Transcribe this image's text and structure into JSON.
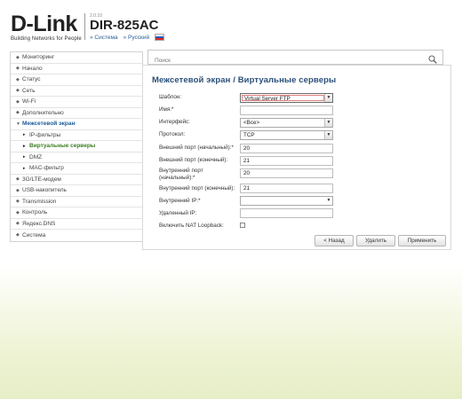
{
  "brand": {
    "logo": "D-Link",
    "tagline": "Building Networks for People"
  },
  "device": {
    "hw": "2.0.10",
    "model": "DIR-825AC",
    "system": "Система",
    "language": "Русский"
  },
  "sidebar": {
    "items": [
      {
        "label": "Мониторинг"
      },
      {
        "label": "Начало"
      },
      {
        "label": "Статус"
      },
      {
        "label": "Сеть"
      },
      {
        "label": "Wi-Fi"
      },
      {
        "label": "Дополнительно"
      },
      {
        "label": "Межсетевой экран"
      },
      {
        "label": "IP-фильтры"
      },
      {
        "label": "Виртуальные серверы"
      },
      {
        "label": "DMZ"
      },
      {
        "label": "MAC-фильтр"
      },
      {
        "label": "3G/LTE-модем"
      },
      {
        "label": "USB-накопитель"
      },
      {
        "label": "Transmission"
      },
      {
        "label": "Контроль"
      },
      {
        "label": "Яндекс.DNS"
      },
      {
        "label": "Система"
      }
    ]
  },
  "search": {
    "placeholder": "Поиск"
  },
  "page": {
    "title": "Межсетевой экран /  Виртуальные серверы"
  },
  "form": {
    "template_label": "Шаблон:",
    "template_value": "Virtual Server FTP",
    "name_label": "Имя:*",
    "name_value": "",
    "interface_label": "Интерфейс:",
    "interface_value": "<Все>",
    "protocol_label": "Протокол:",
    "protocol_value": "TCP",
    "ext_start_label": "Внешний порт (начальный):*",
    "ext_start_value": "20",
    "ext_end_label": "Внешний порт (конечный):",
    "ext_end_value": "21",
    "int_start_label": "Внутренний порт (начальный):*",
    "int_start_value": "20",
    "int_end_label": "Внутренний порт (конечный):",
    "int_end_value": "21",
    "int_ip_label": "Внутренний IP:*",
    "int_ip_value": "",
    "remote_ip_label": "Удаленный IP:",
    "remote_ip_value": "",
    "nat_loopback_label": "Включить NAT Loopback:",
    "nat_loopback_checked": false
  },
  "buttons": {
    "back": "< Назад",
    "delete": "Удалить",
    "apply": "Применить"
  },
  "colors": {
    "accent": "#1b5a9a",
    "current": "#3a7d20"
  }
}
